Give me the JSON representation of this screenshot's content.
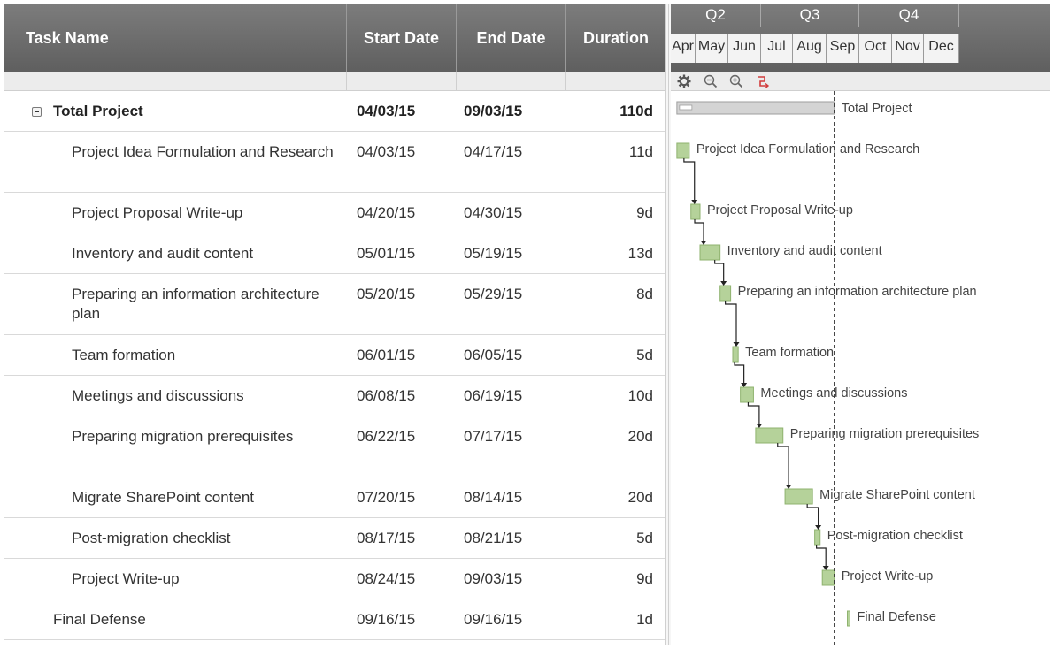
{
  "columns": {
    "task_name": "Task Name",
    "start_date": "Start Date",
    "end_date": "End Date",
    "duration": "Duration"
  },
  "timescale": {
    "quarters": [
      "Q2",
      "Q3",
      "Q4"
    ],
    "months": [
      "Apr",
      "May",
      "Jun",
      "Jul",
      "Aug",
      "Sep",
      "Oct",
      "Nov",
      "Dec"
    ]
  },
  "toolbar": {
    "icons": [
      "gear-icon",
      "zoom-out-icon",
      "zoom-in-icon",
      "critical-path-icon"
    ]
  },
  "tasks": [
    {
      "name": "Total Project",
      "start": "04/03/15",
      "end": "09/03/15",
      "duration": "110d",
      "type": "summary"
    },
    {
      "name": "Project Idea Formulation and Research",
      "start": "04/03/15",
      "end": "04/17/15",
      "duration": "11d",
      "type": "task"
    },
    {
      "name": "Project Proposal Write-up",
      "start": "04/20/15",
      "end": "04/30/15",
      "duration": "9d",
      "type": "task"
    },
    {
      "name": "Inventory and audit content",
      "start": "05/01/15",
      "end": "05/19/15",
      "duration": "13d",
      "type": "task"
    },
    {
      "name": "Preparing an information architecture plan",
      "start": "05/20/15",
      "end": "05/29/15",
      "duration": "8d",
      "type": "task"
    },
    {
      "name": "Team formation",
      "start": "06/01/15",
      "end": "06/05/15",
      "duration": "5d",
      "type": "task"
    },
    {
      "name": "Meetings and discussions",
      "start": "06/08/15",
      "end": "06/19/15",
      "duration": "10d",
      "type": "task"
    },
    {
      "name": "Preparing migration prerequisites",
      "start": "06/22/15",
      "end": "07/17/15",
      "duration": "20d",
      "type": "task"
    },
    {
      "name": "Migrate SharePoint content",
      "start": "07/20/15",
      "end": "08/14/15",
      "duration": "20d",
      "type": "task"
    },
    {
      "name": "Post-migration checklist",
      "start": "08/17/15",
      "end": "08/21/15",
      "duration": "5d",
      "type": "task"
    },
    {
      "name": "Project Write-up",
      "start": "08/24/15",
      "end": "09/03/15",
      "duration": "9d",
      "type": "task"
    },
    {
      "name": "Final Defense",
      "start": "09/16/15",
      "end": "09/16/15",
      "duration": "1d",
      "type": "top"
    }
  ],
  "status_date": "09/03/15",
  "colors": {
    "header": "#6b6b6b",
    "task_bar": "#b5d29a",
    "task_bar_border": "#8fb36f",
    "summary_bar": "#d4d4d4",
    "status_line": "#333333",
    "critical_icon": "#d23c3c"
  }
}
